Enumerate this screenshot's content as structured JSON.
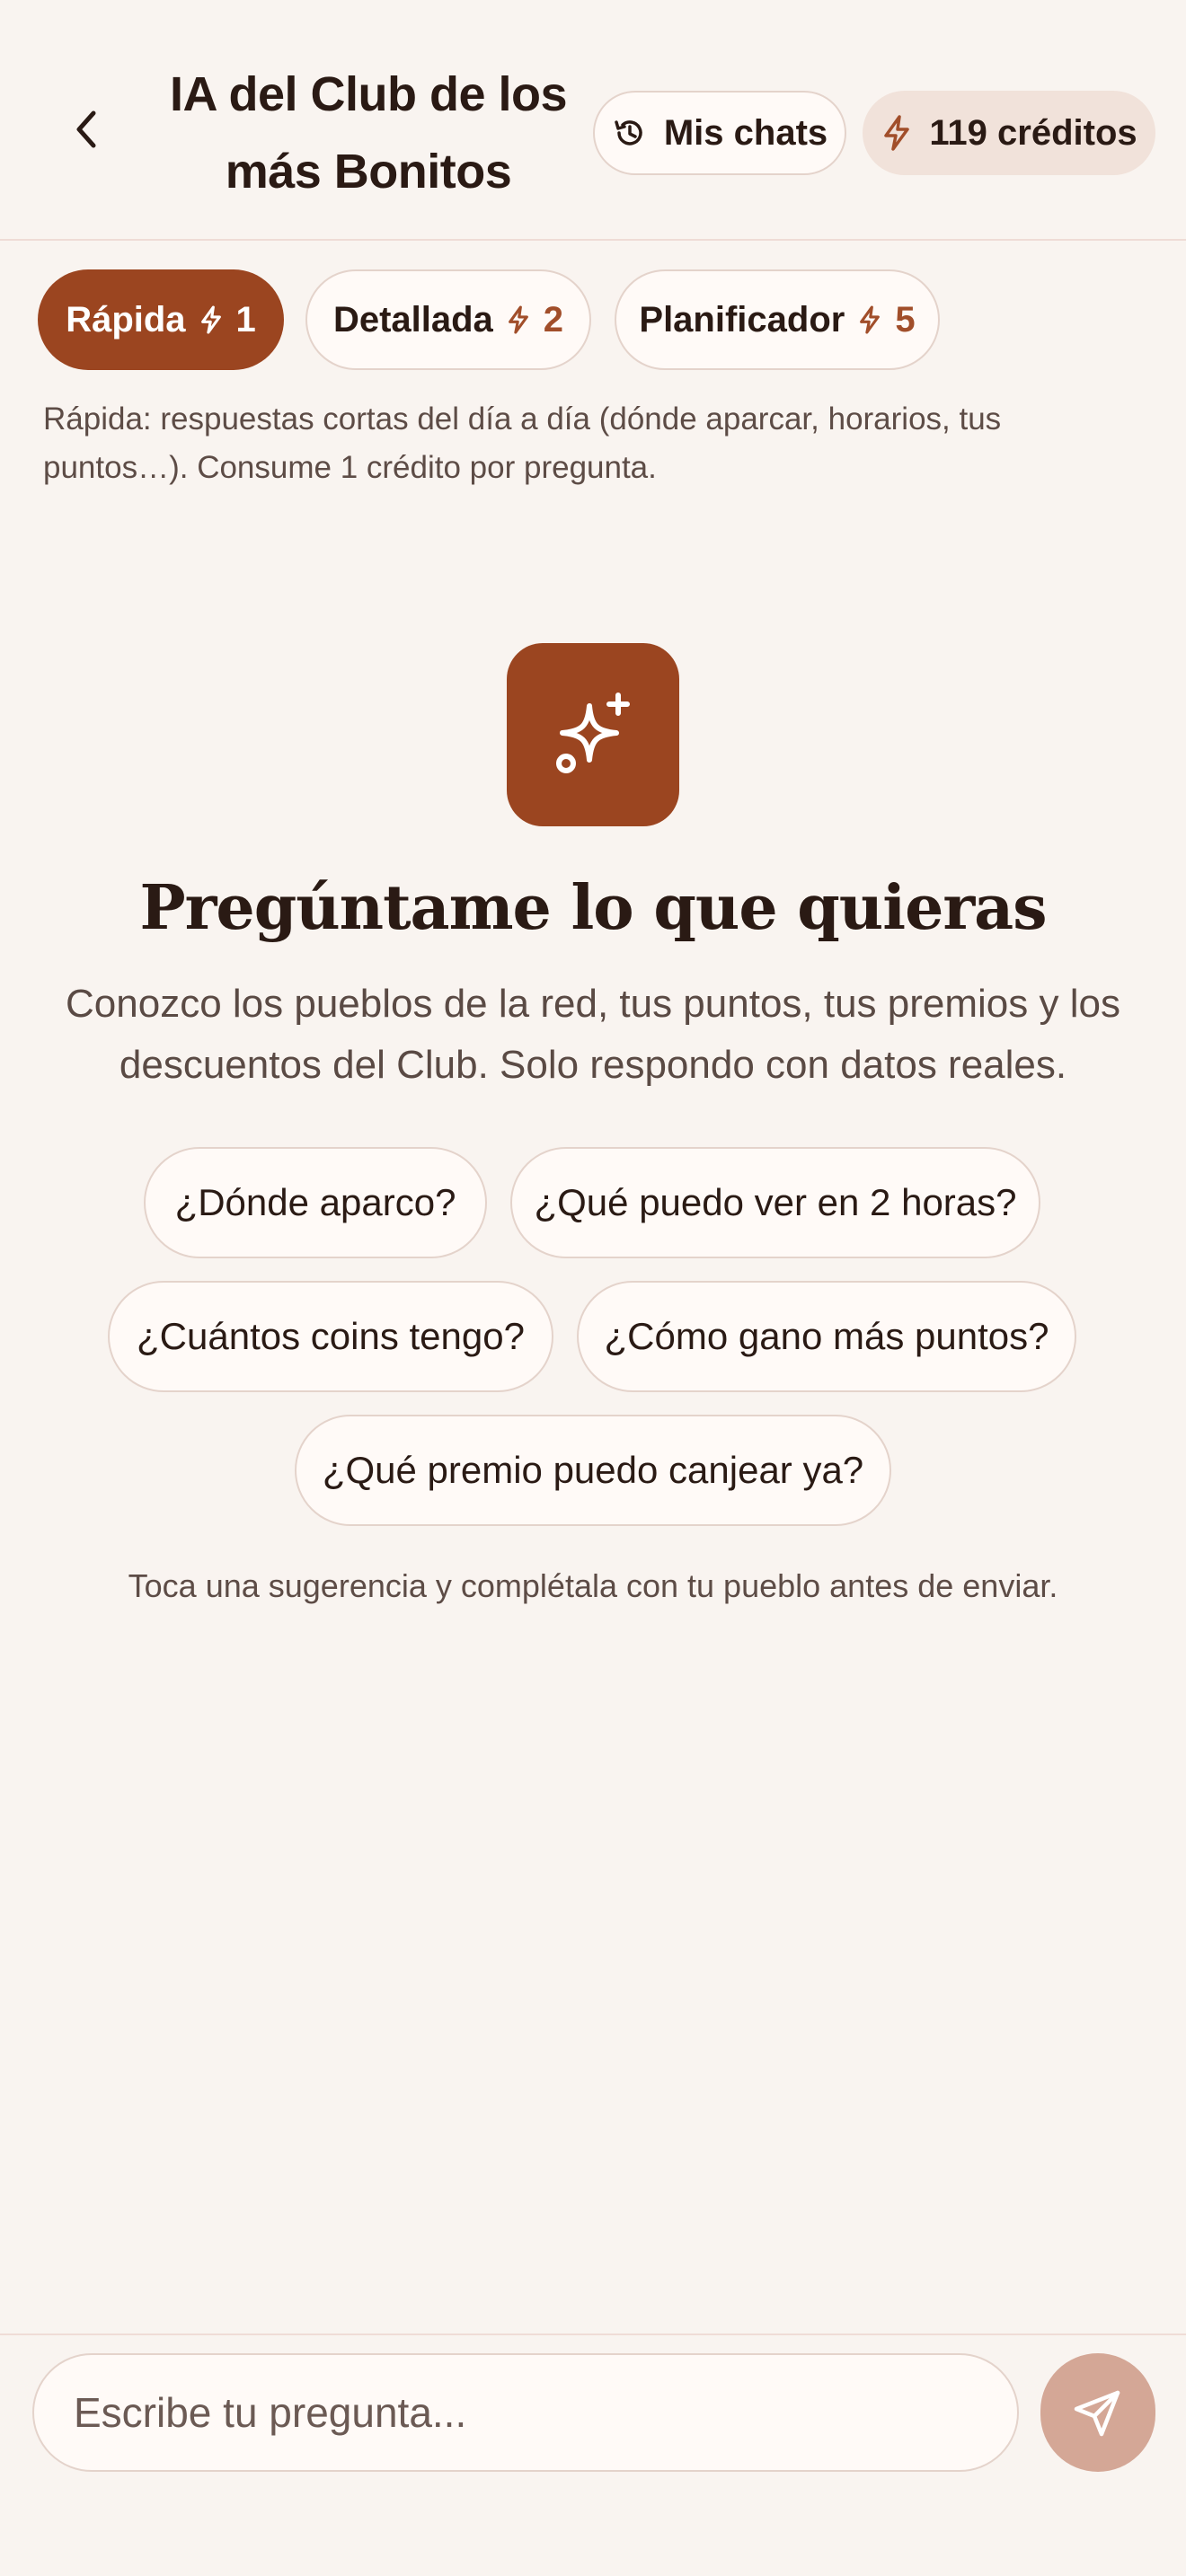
{
  "header": {
    "title": "IA del Club de los más Bonitos",
    "chats_label": "Mis chats",
    "credits_label": "119 créditos",
    "accent_color": "#9b4520"
  },
  "modes": [
    {
      "label": "Rápida",
      "cost": "1",
      "active": true
    },
    {
      "label": "Detallada",
      "cost": "2",
      "active": false
    },
    {
      "label": "Planificador",
      "cost": "5",
      "active": false
    }
  ],
  "mode_description": "Rápida: respuestas cortas del día a día (dónde aparcar, horarios, tus puntos…). Consume 1 crédito por pregunta.",
  "hero": {
    "title": "Pregúntame lo que quieras",
    "subtitle": "Conozco los pueblos de la red, tus puntos, tus premios y los descuentos del Club. Solo respondo con datos reales."
  },
  "suggestions": [
    "¿Dónde aparco?",
    "¿Qué puedo ver en 2 horas?",
    "¿Cuántos coins tengo?",
    "¿Cómo gano más puntos?",
    "¿Qué premio puedo canjear ya?"
  ],
  "hint": "Toca una sugerencia y complétala con tu pueblo antes de enviar.",
  "composer": {
    "placeholder": "Escribe tu pregunta..."
  },
  "icons": {
    "back": "chevron-left-icon",
    "history": "history-icon",
    "bolt": "bolt-icon",
    "sparkles": "sparkles-icon",
    "send": "send-icon"
  }
}
